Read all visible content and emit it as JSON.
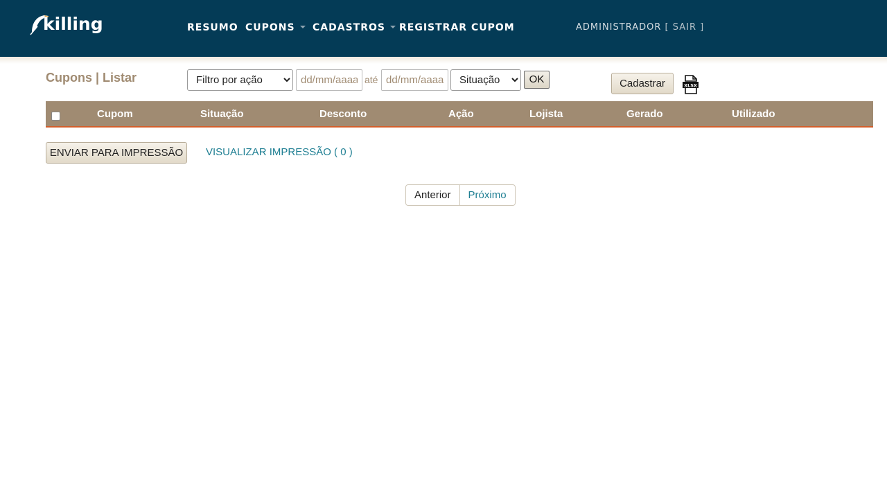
{
  "brand": {
    "logo_text": "killing"
  },
  "nav": {
    "items": [
      {
        "label": "RESUMO"
      },
      {
        "label": "CUPONS"
      },
      {
        "label": "CADASTROS"
      },
      {
        "label": "REGISTRAR CUPOM"
      }
    ]
  },
  "user": {
    "name": "ADMINISTRADOR",
    "logout_label": "[ SAIR ]"
  },
  "page": {
    "title": "Cupons | Listar"
  },
  "filters": {
    "action_filter": "Filtro por ação",
    "date_from_placeholder": "dd/mm/aaaa",
    "date_between_label": "até",
    "date_to_placeholder": "dd/mm/aaaa",
    "status_filter": "Situação",
    "ok_label": "OK"
  },
  "toolbar": {
    "register_label": "Cadastrar",
    "export_icon": "xlsx-file-icon",
    "export_text": "XLSX"
  },
  "table": {
    "columns": [
      "Cupom",
      "Situação",
      "Desconto",
      "Ação",
      "Lojista",
      "Gerado",
      "Utilizado"
    ],
    "rows": []
  },
  "actions": {
    "send_to_print_label": "ENVIAR PARA IMPRESSÃO",
    "view_print_label": "VISUALIZAR IMPRESSÃO ( 0 )"
  },
  "pagination": {
    "prev_label": "Anterior",
    "next_label": "Próximo"
  },
  "colors": {
    "header_bg": "#043b56",
    "accent_tan": "#a08b72",
    "link_teal": "#1f7f93",
    "table_border": "#d35e2a"
  }
}
